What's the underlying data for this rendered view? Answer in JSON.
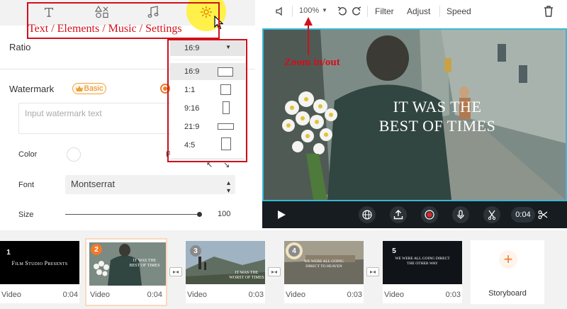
{
  "top_tabs": {
    "annotation": "Text / Elements / Music / Settings"
  },
  "ratio": {
    "label": "Ratio",
    "selected": "16:9",
    "options": [
      {
        "label": "16:9"
      },
      {
        "label": "1:1"
      },
      {
        "label": "9:16"
      },
      {
        "label": "21:9"
      },
      {
        "label": "4:5"
      }
    ]
  },
  "watermark": {
    "label": "Watermark",
    "badge": "Basic",
    "placeholder": "Input watermark text"
  },
  "color": {
    "label": "Color",
    "partial_label": "P"
  },
  "font": {
    "label": "Font",
    "value": "Montserrat"
  },
  "size": {
    "label": "Size",
    "value": "100",
    "level": 1.0
  },
  "toolbar": {
    "zoom": "100%",
    "filter": "Filter",
    "adjust": "Adjust",
    "speed": "Speed",
    "zoom_annotation": "Zoom in/out"
  },
  "preview": {
    "caption_line1": "IT WAS THE",
    "caption_line2": "BEST OF TIMES"
  },
  "playbar": {
    "time": "0:04"
  },
  "storyboard": {
    "clips": [
      {
        "num": "1",
        "type": "Video",
        "duration": "0:04",
        "thumb_text": "Film Studio Presents"
      },
      {
        "num": "2",
        "type": "Video",
        "duration": "0:04",
        "thumb_text_1": "IT WAS THE",
        "thumb_text_2": "BEST OF TIMES"
      },
      {
        "num": "3",
        "type": "Video",
        "duration": "0:03",
        "thumb_text_1": "IT WAS THE",
        "thumb_text_2": "WORST OF TIMES"
      },
      {
        "num": "4",
        "type": "Video",
        "duration": "0:03",
        "thumb_text_1": "WE WERE ALL GOING",
        "thumb_text_2": "DIRECT TO HEAVEN"
      },
      {
        "num": "5",
        "type": "Video",
        "duration": "0:03",
        "thumb_text_1": "WE WERE ALL GOING DIRECT",
        "thumb_text_2": "THE OTHER WAY"
      }
    ],
    "add_label": "Storyboard"
  },
  "colors": {
    "accent": "#f07a2a",
    "annotation_red": "#d20f1a",
    "preview_border": "#38b8d6",
    "highlight_yellow": "#fff14a"
  }
}
